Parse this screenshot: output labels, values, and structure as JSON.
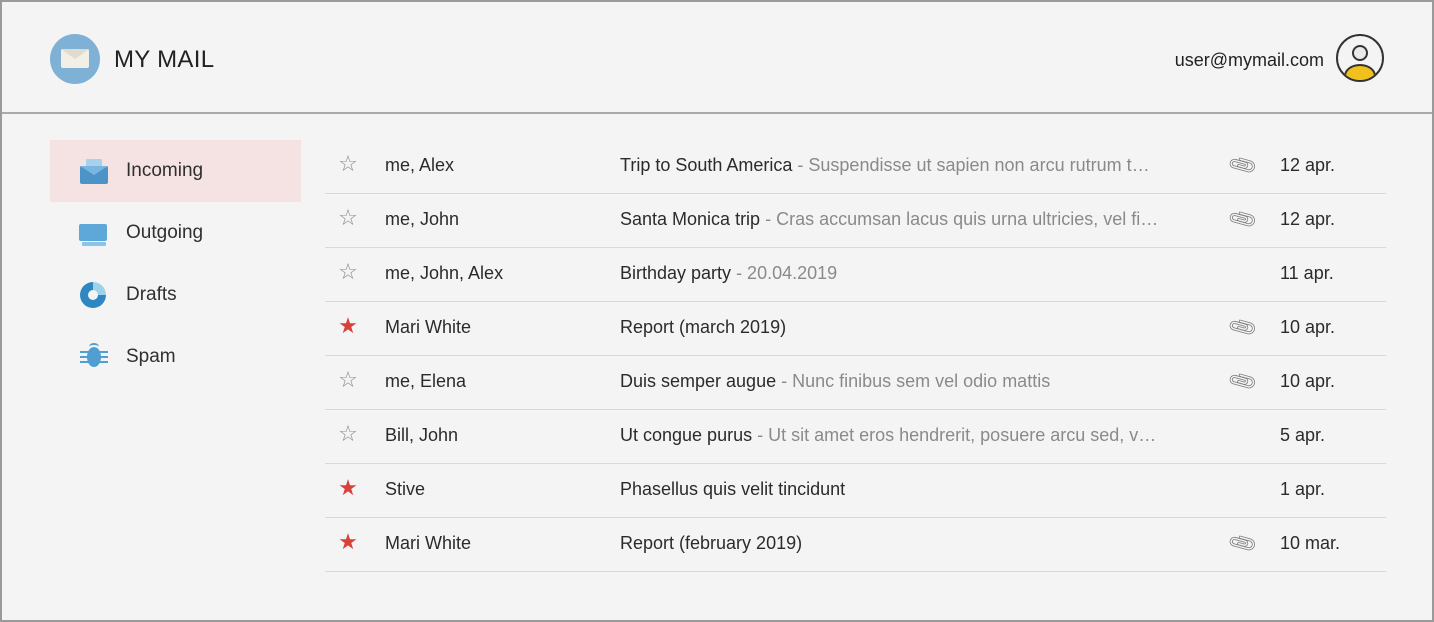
{
  "header": {
    "app_title": "MY MAIL",
    "user_email": "user@mymail.com",
    "logo_icon": "envelope-icon",
    "avatar_icon": "user-avatar-icon"
  },
  "sidebar": {
    "items": [
      {
        "label": "Incoming",
        "icon": "inbox-icon",
        "active": true
      },
      {
        "label": "Outgoing",
        "icon": "outbox-icon",
        "active": false
      },
      {
        "label": "Drafts",
        "icon": "drafts-icon",
        "active": false
      },
      {
        "label": "Spam",
        "icon": "spam-bug-icon",
        "active": false
      }
    ]
  },
  "emails": [
    {
      "starred": false,
      "sender": "me, Alex",
      "subject": "Trip to South America",
      "preview": " - Suspendisse ut sapien non arcu rutrum t…",
      "attachment": true,
      "date": "12 apr."
    },
    {
      "starred": false,
      "sender": "me, John",
      "subject": "Santa Monica trip",
      "preview": " - Cras accumsan lacus quis urna ultricies, vel fi…",
      "attachment": true,
      "date": "12 apr."
    },
    {
      "starred": false,
      "sender": "me, John, Alex",
      "subject": "Birthday party",
      "preview": " - 20.04.2019",
      "attachment": false,
      "date": "11 apr."
    },
    {
      "starred": true,
      "sender": "Mari White",
      "subject": "Report (march 2019)",
      "preview": "",
      "attachment": true,
      "date": "10 apr."
    },
    {
      "starred": false,
      "sender": "me, Elena",
      "subject": "Duis semper augue",
      "preview": " - Nunc finibus sem vel odio mattis",
      "attachment": true,
      "date": "10 apr."
    },
    {
      "starred": false,
      "sender": "Bill, John",
      "subject": "Ut congue purus",
      "preview": " - Ut sit amet eros hendrerit, posuere arcu sed, v…",
      "attachment": false,
      "date": "5 apr."
    },
    {
      "starred": true,
      "sender": "Stive",
      "subject": "Phasellus quis velit tincidunt",
      "preview": "",
      "attachment": false,
      "date": "1 apr."
    },
    {
      "starred": true,
      "sender": "Mari White",
      "subject": "Report (february 2019)",
      "preview": "",
      "attachment": true,
      "date": "10 mar."
    }
  ],
  "colors": {
    "accent": "#7fb1d6",
    "active_nav_bg": "#f5e2e2",
    "star_on": "#d8423b",
    "star_off": "#8b8b8b",
    "preview_text": "#8a8a8a"
  }
}
